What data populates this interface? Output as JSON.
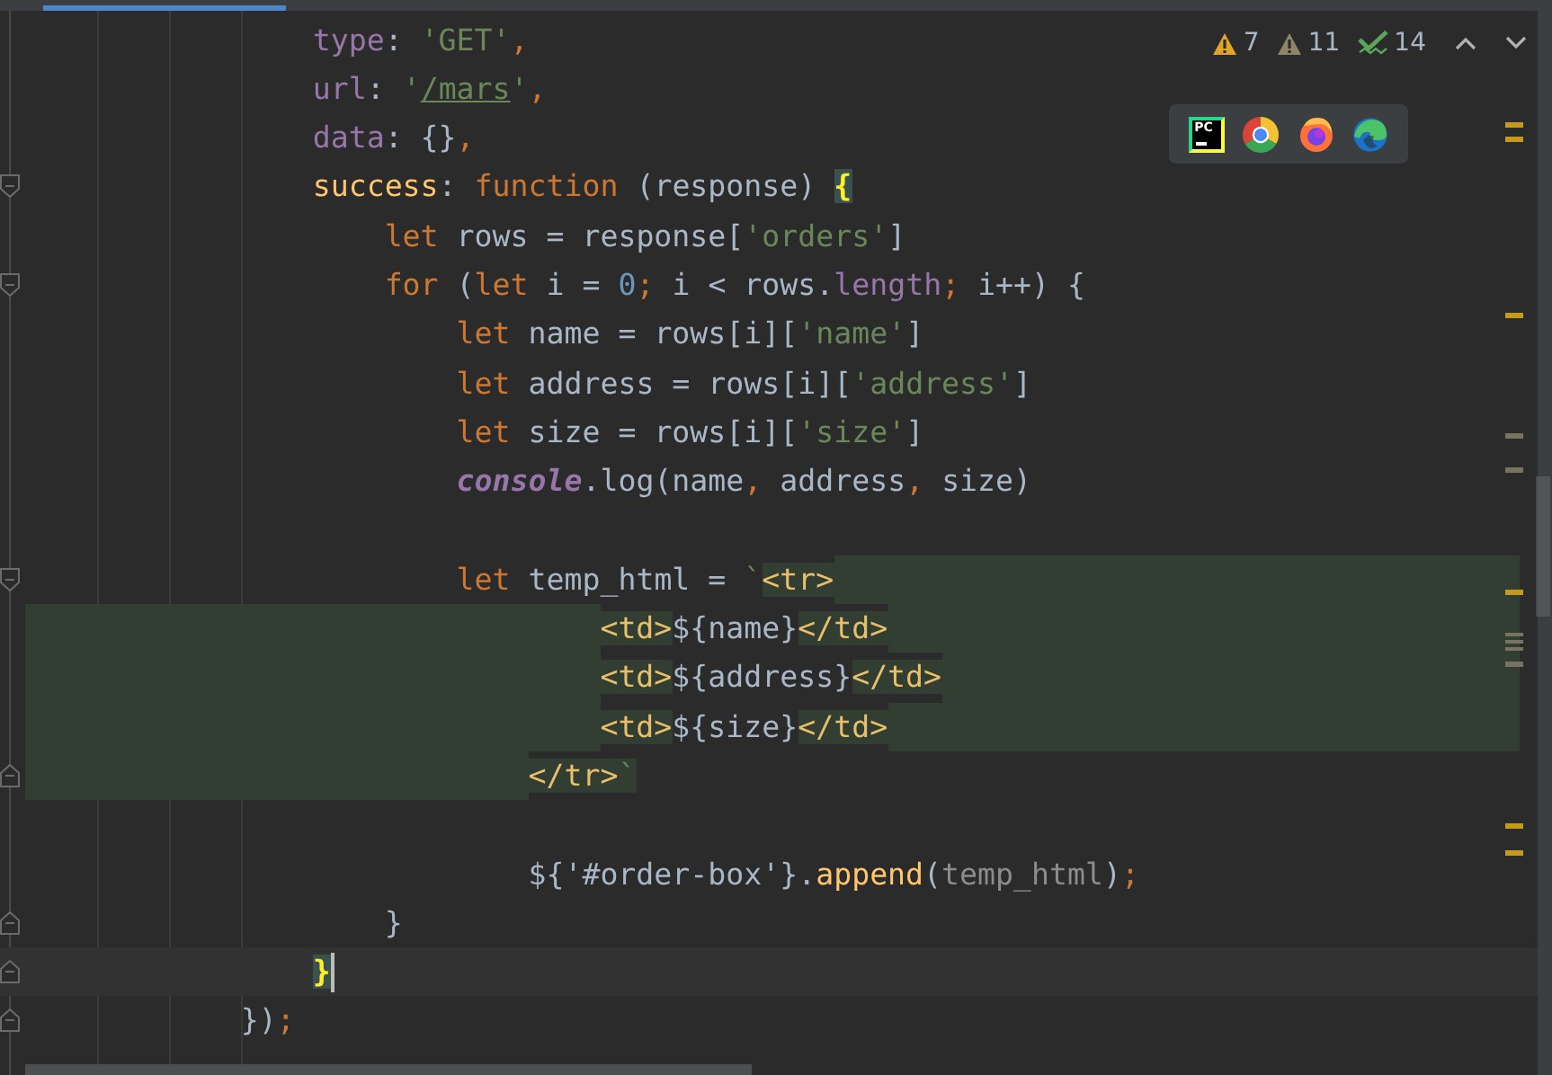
{
  "inspections": [
    {
      "kind": "warning",
      "count": "7"
    },
    {
      "kind": "weak_warning",
      "count": "11"
    },
    {
      "kind": "typo",
      "count": "14"
    }
  ],
  "browsers": [
    {
      "kind": "pycharm",
      "label": "PC"
    },
    {
      "kind": "chrome"
    },
    {
      "kind": "firefox"
    },
    {
      "kind": "edge"
    }
  ],
  "lines": [
    {
      "kind": "group",
      "children": [
        {
          "kind": "group",
          "children": [
            {
              "kind": "code",
              "tokens": [
                {
                  "text": "type",
                  "kind": "prop"
                },
                {
                  "text": ": ",
                  "kind": "plain"
                },
                {
                  "text": "'GET'",
                  "kind": "str"
                },
                {
                  "text": ",",
                  "kind": "punc"
                }
              ]
            },
            {
              "kind": "code",
              "tokens": [
                {
                  "text": "url",
                  "kind": "prop"
                },
                {
                  "text": ": ",
                  "kind": "plain"
                },
                {
                  "text": "'",
                  "kind": "str"
                },
                {
                  "text": "/mars",
                  "kind": "link"
                },
                {
                  "text": "'",
                  "kind": "str"
                },
                {
                  "text": ",",
                  "kind": "punc"
                }
              ]
            },
            {
              "kind": "code",
              "tokens": [
                {
                  "text": "data",
                  "kind": "prop"
                },
                {
                  "text": ": {}",
                  "kind": "plain"
                },
                {
                  "text": ",",
                  "kind": "punc"
                }
              ]
            },
            {
              "kind": "code",
              "fold_start": true,
              "tokens": [
                {
                  "text": "success",
                  "kind": "fn"
                },
                {
                  "text": ": ",
                  "kind": "plain"
                },
                {
                  "text": "function",
                  "kind": "kw"
                },
                {
                  "text": " (response) ",
                  "kind": "plain"
                },
                {
                  "text": "{",
                  "kind": "match"
                }
              ],
              "children": [
                {
                  "kind": "code",
                  "tokens": [
                    {
                      "text": "let",
                      "kind": "kw"
                    },
                    {
                      "text": " rows = response[",
                      "kind": "plain"
                    },
                    {
                      "text": "'orders'",
                      "kind": "str"
                    },
                    {
                      "text": "]",
                      "kind": "plain"
                    }
                  ]
                },
                {
                  "kind": "code",
                  "fold_start": true,
                  "tokens": [
                    {
                      "text": "for",
                      "kind": "kw"
                    },
                    {
                      "text": " (",
                      "kind": "plain"
                    },
                    {
                      "text": "let",
                      "kind": "kw"
                    },
                    {
                      "text": " i = ",
                      "kind": "plain"
                    },
                    {
                      "text": "0",
                      "kind": "num"
                    },
                    {
                      "text": ";",
                      "kind": "punc"
                    },
                    {
                      "text": " i < rows.",
                      "kind": "plain"
                    },
                    {
                      "text": "length",
                      "kind": "prop"
                    },
                    {
                      "text": ";",
                      "kind": "punc"
                    },
                    {
                      "text": " i++) {",
                      "kind": "plain"
                    }
                  ],
                  "children": [
                    {
                      "kind": "code",
                      "tokens": [
                        {
                          "text": "let",
                          "kind": "kw"
                        },
                        {
                          "text": " name = rows[i][",
                          "kind": "plain"
                        },
                        {
                          "text": "'name'",
                          "kind": "str"
                        },
                        {
                          "text": "]",
                          "kind": "plain"
                        }
                      ]
                    },
                    {
                      "kind": "code",
                      "tokens": [
                        {
                          "text": "let",
                          "kind": "kw"
                        },
                        {
                          "text": " address = rows[i][",
                          "kind": "plain"
                        },
                        {
                          "text": "'address'",
                          "kind": "str"
                        },
                        {
                          "text": "]",
                          "kind": "plain"
                        }
                      ]
                    },
                    {
                      "kind": "code",
                      "tokens": [
                        {
                          "text": "let",
                          "kind": "kw"
                        },
                        {
                          "text": " size = rows[i][",
                          "kind": "plain"
                        },
                        {
                          "text": "'size'",
                          "kind": "str"
                        },
                        {
                          "text": "]",
                          "kind": "plain"
                        }
                      ]
                    },
                    {
                      "kind": "code",
                      "tokens": [
                        {
                          "text": "console",
                          "kind": "global"
                        },
                        {
                          "text": ".log(name",
                          "kind": "plain"
                        },
                        {
                          "text": ",",
                          "kind": "punc"
                        },
                        {
                          "text": " address",
                          "kind": "plain"
                        },
                        {
                          "text": ",",
                          "kind": "punc"
                        },
                        {
                          "text": " size)",
                          "kind": "plain"
                        }
                      ]
                    },
                    {
                      "kind": "blank"
                    },
                    {
                      "kind": "code",
                      "fold_start": true,
                      "tail": true,
                      "tokens": [
                        {
                          "text": "let",
                          "kind": "kw"
                        },
                        {
                          "text": " temp_html = ",
                          "kind": "plain"
                        },
                        {
                          "text": "`",
                          "kind": "str"
                        },
                        {
                          "text": "<tr>",
                          "kind": "tag",
                          "inj": true
                        }
                      ],
                      "children": [
                        {
                          "kind": "group",
                          "children": [
                            {
                              "kind": "code",
                              "indent_inj": true,
                              "tail": true,
                              "tokens": [
                                {
                                  "text": "<td>",
                                  "kind": "tag",
                                  "inj": true
                                },
                                {
                                  "text": "${name}",
                                  "kind": "plain"
                                },
                                {
                                  "text": "</td>",
                                  "kind": "tag",
                                  "inj": true
                                }
                              ]
                            },
                            {
                              "kind": "code",
                              "indent_inj": true,
                              "tail": true,
                              "tokens": [
                                {
                                  "text": "<td>",
                                  "kind": "tag",
                                  "inj": true
                                },
                                {
                                  "text": "${address}",
                                  "kind": "plain"
                                },
                                {
                                  "text": "</td>",
                                  "kind": "tag",
                                  "inj": true
                                }
                              ]
                            },
                            {
                              "kind": "code",
                              "indent_inj": true,
                              "tail": true,
                              "tokens": [
                                {
                                  "text": "<td>",
                                  "kind": "tag",
                                  "inj": true
                                },
                                {
                                  "text": "${size}",
                                  "kind": "plain"
                                },
                                {
                                  "text": "</td>",
                                  "kind": "tag",
                                  "inj": true
                                }
                              ]
                            }
                          ]
                        },
                        {
                          "kind": "code",
                          "indent_inj": true,
                          "fold_end": true,
                          "tokens": [
                            {
                              "text": "</tr>",
                              "kind": "tag",
                              "inj": true
                            },
                            {
                              "text": "`",
                              "kind": "str",
                              "inj": true
                            }
                          ]
                        }
                      ]
                    },
                    {
                      "kind": "blank"
                    },
                    {
                      "kind": "group",
                      "children": [
                        {
                          "kind": "code",
                          "tokens": [
                            {
                              "text": "${'#order-box'}.",
                              "kind": "plain"
                            },
                            {
                              "text": "append",
                              "kind": "fn"
                            },
                            {
                              "text": "(",
                              "kind": "plain"
                            },
                            {
                              "text": "temp_html",
                              "kind": "dim"
                            },
                            {
                              "text": ")",
                              "kind": "plain"
                            },
                            {
                              "text": ";",
                              "kind": "punc"
                            }
                          ]
                        }
                      ]
                    }
                  ]
                },
                {
                  "kind": "code",
                  "fold_end": true,
                  "tokens": [
                    {
                      "text": "}",
                      "kind": "plain"
                    }
                  ]
                }
              ]
            },
            {
              "kind": "code",
              "fold_end": true,
              "current": true,
              "caret": true,
              "tokens": [
                {
                  "text": "}",
                  "kind": "match"
                }
              ]
            }
          ]
        },
        {
          "kind": "code",
          "fold_end": true,
          "tokens": [
            {
              "text": "})",
              "kind": "plain"
            },
            {
              "text": ";",
              "kind": "punc"
            }
          ]
        }
      ]
    }
  ]
}
